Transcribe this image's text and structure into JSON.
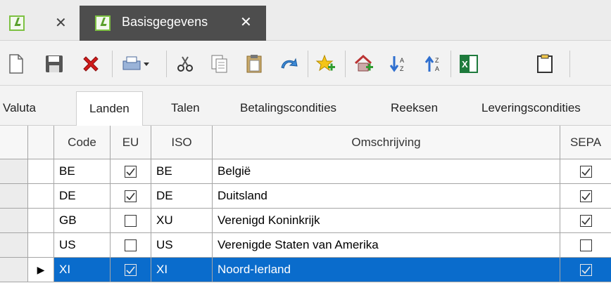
{
  "tabs": [
    {
      "label": ""
    },
    {
      "label": "Basisgegevens"
    }
  ],
  "close_glyph": "✕",
  "toolbar_icons": [
    "new-document-icon",
    "save-icon",
    "delete-icon",
    "print-icon",
    "cut-icon",
    "copy-icon",
    "paste-icon",
    "undo-icon",
    "favorite-add-icon",
    "home-add-icon",
    "sort-ascending-icon",
    "sort-descending-icon",
    "excel-export-icon",
    "clipboard-icon"
  ],
  "subtabs": [
    "Valuta",
    "Landen",
    "Talen",
    "Betalingscondities",
    "Reeksen",
    "Leveringscondities"
  ],
  "grid": {
    "columns": [
      "Code",
      "EU",
      "ISO",
      "Omschrijving",
      "SEPA"
    ],
    "rows": [
      {
        "code": "BE",
        "eu": true,
        "iso": "BE",
        "desc": "België",
        "sepa": true
      },
      {
        "code": "DE",
        "eu": true,
        "iso": "DE",
        "desc": "Duitsland",
        "sepa": true
      },
      {
        "code": "GB",
        "eu": false,
        "iso": "XU",
        "desc": "Verenigd Koninkrijk",
        "sepa": true
      },
      {
        "code": "US",
        "eu": false,
        "iso": "US",
        "desc": "Verenigde Staten van Amerika",
        "sepa": false
      },
      {
        "code": "XI",
        "eu": true,
        "iso": "XI",
        "desc": "Noord-Ierland",
        "sepa": true
      }
    ],
    "selected_row": 4,
    "current_row_glyph": "▶"
  },
  "colors": {
    "selection": "#0a6ccc",
    "tab_active_bg": "#4d4d4d"
  }
}
